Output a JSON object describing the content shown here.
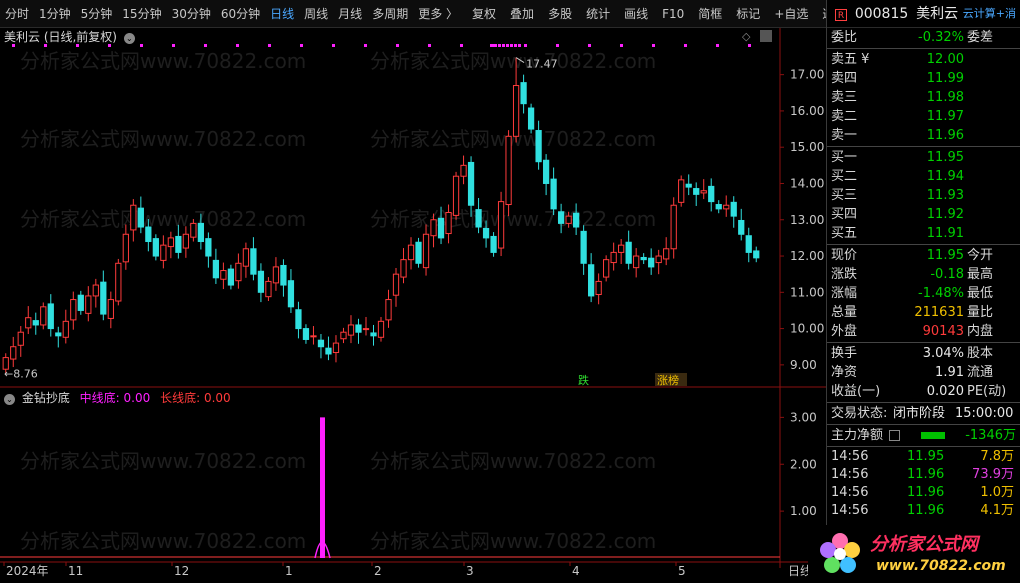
{
  "toolbar": {
    "periods": [
      "分时",
      "1分钟",
      "5分钟",
      "15分钟",
      "30分钟",
      "60分钟",
      "日线",
      "周线",
      "月线",
      "多周期",
      "更多 〉"
    ],
    "active_period": "日线",
    "tools": [
      "复权",
      "叠加",
      "多股",
      "统计",
      "画线",
      "F10",
      "简框",
      "标记",
      "+自选",
      "返回"
    ]
  },
  "chart": {
    "title": "美利云 (日线,前复权)",
    "high_label": "17.47",
    "low_label": "8.76",
    "y_ticks": [
      "17.00",
      "16.00",
      "15.00",
      "14.00",
      "13.00",
      "12.00",
      "11.00",
      "10.00",
      "9.00"
    ],
    "events": [
      "跌",
      "涨榜"
    ],
    "watermark": "分析家公式网www.70822.com"
  },
  "indicator": {
    "name": "金钻抄底",
    "mid_label": "中线底:",
    "mid_value": "0.00",
    "long_label": "长线底:",
    "long_value": "0.00",
    "y_ticks": [
      "3.00",
      "2.00",
      "1.00"
    ]
  },
  "x_axis": {
    "labels": [
      "2024年",
      "11",
      "12",
      "1",
      "2",
      "3",
      "4",
      "5"
    ],
    "period_tab": "日线"
  },
  "colors": {
    "up": "#ff3b3b",
    "down": "#30e0e0",
    "signal": "#ff20ff",
    "active_tab": "#4aa8ff"
  },
  "chart_data": {
    "type": "candlestick",
    "title": "美利云 (日线,前复权)",
    "ylim": [
      8.5,
      17.9
    ],
    "high": 17.47,
    "low": 8.76,
    "closes": [
      9.2,
      9.5,
      9.9,
      10.3,
      10.1,
      10.6,
      10.0,
      9.8,
      10.2,
      10.8,
      10.5,
      10.9,
      11.2,
      10.4,
      10.8,
      11.8,
      12.6,
      13.4,
      12.8,
      12.4,
      12.0,
      12.3,
      12.5,
      12.1,
      12.6,
      12.9,
      12.4,
      12.0,
      11.4,
      11.6,
      11.2,
      11.8,
      12.2,
      11.5,
      11.0,
      11.3,
      11.7,
      11.2,
      10.6,
      10.0,
      9.7,
      9.8,
      9.5,
      9.3,
      9.6,
      9.9,
      10.1,
      9.9,
      10.0,
      9.8,
      10.2,
      10.8,
      11.5,
      11.9,
      12.3,
      11.8,
      12.6,
      13.0,
      12.5,
      13.2,
      14.2,
      14.5,
      13.4,
      12.8,
      12.5,
      12.1,
      13.5,
      15.3,
      16.7,
      16.2,
      15.5,
      14.6,
      14.0,
      13.3,
      12.9,
      13.1,
      12.8,
      11.8,
      10.9,
      11.3,
      11.9,
      12.1,
      12.3,
      11.8,
      12.0,
      11.9,
      11.7,
      12.0,
      12.2,
      13.4,
      14.1,
      13.9,
      13.7,
      13.8,
      13.5,
      13.3,
      13.4,
      13.1,
      12.6,
      12.1,
      11.95
    ]
  },
  "panel": {
    "code": "000815",
    "name": "美利云",
    "badge": "R",
    "cloud": "云计算+消",
    "weibi": {
      "label": "委比",
      "value": "-0.32%",
      "right": "委差"
    },
    "asks": [
      {
        "label": "卖五 ¥",
        "price": "12.00"
      },
      {
        "label": "卖四",
        "price": "11.99"
      },
      {
        "label": "卖三",
        "price": "11.98"
      },
      {
        "label": "卖二",
        "price": "11.97"
      },
      {
        "label": "卖一",
        "price": "11.96"
      }
    ],
    "bids": [
      {
        "label": "买一",
        "price": "11.95"
      },
      {
        "label": "买二",
        "price": "11.94"
      },
      {
        "label": "买三",
        "price": "11.93"
      },
      {
        "label": "买四",
        "price": "11.92"
      },
      {
        "label": "买五",
        "price": "11.91"
      }
    ],
    "quote": [
      {
        "label": "现价",
        "value": "11.95",
        "right": "今开",
        "color": "green"
      },
      {
        "label": "涨跌",
        "value": "-0.18",
        "right": "最高",
        "color": "green"
      },
      {
        "label": "涨幅",
        "value": "-1.48%",
        "right": "最低",
        "color": "green"
      },
      {
        "label": "总量",
        "value": "211631",
        "right": "量比",
        "color": "yellow"
      },
      {
        "label": "外盘",
        "value": "90143",
        "right": "内盘",
        "color": "red"
      }
    ],
    "stats": [
      {
        "label": "换手",
        "value": "3.04%",
        "right": "股本"
      },
      {
        "label": "净资",
        "value": "1.91",
        "right": "流通"
      },
      {
        "label": "收益(一)",
        "value": "0.020",
        "right": "PE(动)"
      }
    ],
    "status_label": "交易状态:",
    "status_value": "闭市阶段",
    "status_time": "15:00:00",
    "flow_label": "主力净额",
    "flow_value": "-1346万",
    "trades": [
      {
        "time": "14:56",
        "price": "11.95",
        "qty": "7.8万",
        "color": "yellow"
      },
      {
        "time": "14:56",
        "price": "11.96",
        "qty": "73.9万",
        "color": "magenta"
      },
      {
        "time": "14:56",
        "price": "11.96",
        "qty": "1.0万",
        "color": "yellow"
      },
      {
        "time": "14:56",
        "price": "11.96",
        "qty": "4.1万",
        "color": "yellow"
      }
    ],
    "logo_title": "分析家公式网",
    "logo_url": "www.70822.com"
  }
}
